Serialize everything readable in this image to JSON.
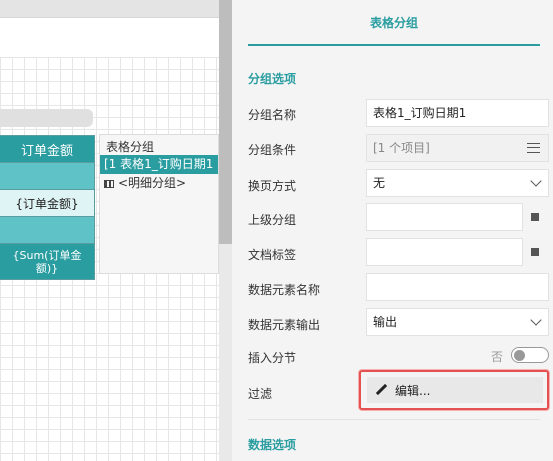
{
  "canvas": {
    "table": {
      "header": "订单金额",
      "detail": "{订单金额}",
      "footer": "{Sum(订单金额)}"
    },
    "group_panel": {
      "title": "表格分组",
      "selected": "[1 表格1_订购日期1",
      "detail_item": "<明细分组>"
    }
  },
  "props": {
    "tab": "表格分组",
    "sections": {
      "group_options": "分组选项",
      "data_options": "数据选项"
    },
    "rows": {
      "group_name": {
        "label": "分组名称",
        "value": "表格1_订购日期1"
      },
      "group_condition": {
        "label": "分组条件",
        "value": "[1 个项目]"
      },
      "page_break": {
        "label": "换页方式",
        "value": "无"
      },
      "parent_group": {
        "label": "上级分组",
        "value": ""
      },
      "doc_label": {
        "label": "文档标签",
        "value": ""
      },
      "data_element_name": {
        "label": "数据元素名称",
        "value": ""
      },
      "data_element_output": {
        "label": "数据元素输出",
        "value": "输出"
      },
      "insert_page_break": {
        "label": "插入分节",
        "toggle_text": "否",
        "toggle_on": false
      },
      "filter": {
        "label": "过滤",
        "button": "编辑..."
      }
    }
  },
  "colors": {
    "accent": "#2a9da0",
    "highlight": "#e55050"
  },
  "icons": [
    "grid-icon",
    "chevron-down-icon",
    "menu-icon",
    "pencil-icon",
    "square-icon"
  ]
}
